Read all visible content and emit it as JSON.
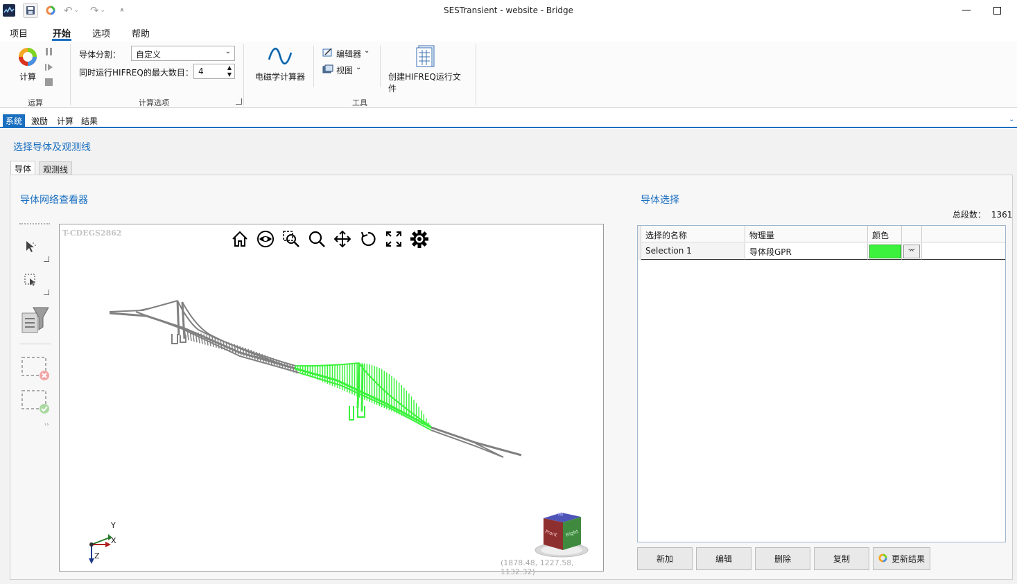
{
  "window": {
    "title": "SESTransient - website - Bridge"
  },
  "menu": {
    "items": [
      "项目",
      "开始",
      "选项",
      "帮助"
    ]
  },
  "ribbon": {
    "compute_label": "计算",
    "group_run": "运算",
    "conductor_split_label": "导体分割：",
    "conductor_split_value": "自定义",
    "max_runs_label": "同时运行HIFREQ的最大数目：",
    "max_runs_value": "4",
    "group_calc_options": "计算选项",
    "em_calc_label": "电磁学计算器",
    "editor_label": "编辑器",
    "view_label": "视图",
    "create_hifreq_label": "创建HIFREQ运行文件",
    "group_tools": "工具"
  },
  "doc_tabs": [
    "系统",
    "激励",
    "计算",
    "结果"
  ],
  "content": {
    "title": "选择导体及观测线",
    "subtabs": [
      "导体",
      "观测线"
    ]
  },
  "viewer": {
    "title": "导体网络查看器",
    "watermark": "T-CDEGS2862",
    "coords": "(1878.48, 1227.58, 1132.32)",
    "axis_labels": {
      "y": "Y",
      "x": "X",
      "z": "Z"
    },
    "cube_labels": {
      "front": "Front",
      "right": "Right",
      "top": "Top"
    }
  },
  "selection": {
    "title": "导体选择",
    "total_label": "总段数：",
    "total_value": "1361",
    "columns": [
      "选择的名称",
      "物理量",
      "颜色"
    ],
    "rows": [
      {
        "name": "Selection 1",
        "quantity": "导体段GPR",
        "color": "#3cf23c"
      }
    ]
  },
  "buttons": {
    "add": "新加",
    "edit": "编辑",
    "delete": "删除",
    "copy": "复制",
    "update": "更新结果"
  },
  "colors": {
    "accent": "#1a6fc0",
    "selection_green": "#3cf23c",
    "mesh_gray": "#808080"
  }
}
